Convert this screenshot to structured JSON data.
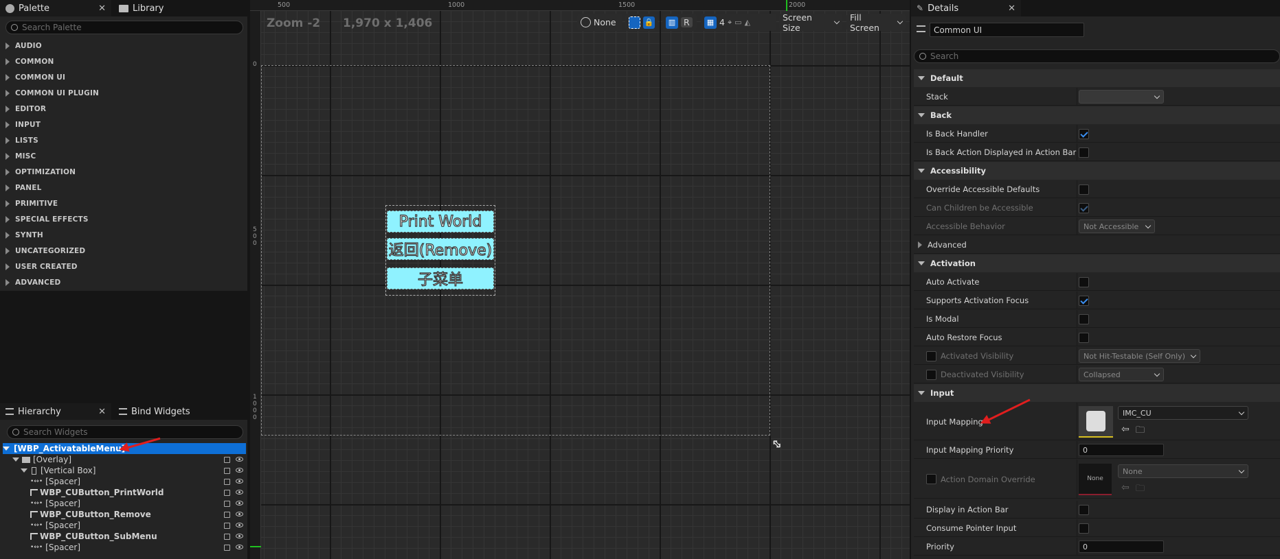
{
  "palette": {
    "tab_palette": "Palette",
    "tab_library": "Library",
    "search_placeholder": "Search Palette",
    "categories": [
      "AUDIO",
      "COMMON",
      "COMMON UI",
      "COMMON UI PLUGIN",
      "EDITOR",
      "INPUT",
      "LISTS",
      "MISC",
      "OPTIMIZATION",
      "PANEL",
      "PRIMITIVE",
      "SPECIAL EFFECTS",
      "SYNTH",
      "UNCATEGORIZED",
      "USER CREATED",
      "ADVANCED"
    ]
  },
  "hierarchy": {
    "tab_hierarchy": "Hierarchy",
    "tab_bind": "Bind Widgets",
    "search_placeholder": "Search Widgets",
    "items": [
      {
        "label": "[WBP_ActivatableMenu]",
        "bold": true
      },
      {
        "label": "[Overlay]"
      },
      {
        "label": "[Vertical Box]"
      },
      {
        "label": "[Spacer]"
      },
      {
        "label": "WBP_CUButton_PrintWorld",
        "bold": true
      },
      {
        "label": "[Spacer]"
      },
      {
        "label": "WBP_CUButton_Remove",
        "bold": true
      },
      {
        "label": "[Spacer]"
      },
      {
        "label": "WBP_CUButton_SubMenu",
        "bold": true
      },
      {
        "label": "[Spacer]"
      }
    ]
  },
  "canvas": {
    "zoom": "Zoom -2",
    "resolution": "1,970 x 1,406",
    "ruler_top": [
      "500",
      "1000",
      "1500",
      "2000"
    ],
    "ruler_left": [
      "0",
      "5\n0\n0",
      "1\n0\n0\n0"
    ],
    "toolbar": {
      "none": "None",
      "r": "R",
      "grid": "4",
      "screen_size": "Screen Size",
      "fill_screen": "Fill Screen"
    },
    "buttons": [
      "Print World",
      "返回(Remove)",
      "子菜单"
    ]
  },
  "details": {
    "tab": "Details",
    "name_value": "Common UI",
    "search_placeholder": "Search",
    "sections": {
      "default": "Default",
      "back": "Back",
      "accessibility": "Accessibility",
      "advanced": "Advanced",
      "activation": "Activation",
      "input": "Input"
    },
    "props": {
      "stack": "Stack",
      "is_back_handler": "Is Back Handler",
      "is_back_action": "Is Back Action Displayed in Action Bar",
      "override_access": "Override Accessible Defaults",
      "can_children": "Can Children be Accessible",
      "accessible_behavior": "Accessible Behavior",
      "accessible_behavior_val": "Not Accessible",
      "auto_activate": "Auto Activate",
      "supports_focus": "Supports Activation Focus",
      "is_modal": "Is Modal",
      "auto_restore": "Auto Restore Focus",
      "activated_vis": "Activated Visibility",
      "activated_vis_val": "Not Hit-Testable (Self Only)",
      "deactivated_vis": "Deactivated Visibility",
      "deactivated_vis_val": "Collapsed",
      "input_mapping": "Input Mapping",
      "input_mapping_val": "IMC_CU",
      "input_mapping_priority": "Input Mapping Priority",
      "input_mapping_priority_val": "0",
      "action_domain": "Action Domain Override",
      "action_domain_thumb": "None",
      "action_domain_val": "None",
      "display_action_bar": "Display in Action Bar",
      "consume_pointer": "Consume Pointer Input",
      "priority": "Priority",
      "priority_val": "0"
    }
  },
  "colors": {
    "accent_blue": "#0e7ad8",
    "selection": "#0e6fd6",
    "arrow_red": "#e01e1e",
    "button_cyan": "#8ff2ff"
  }
}
